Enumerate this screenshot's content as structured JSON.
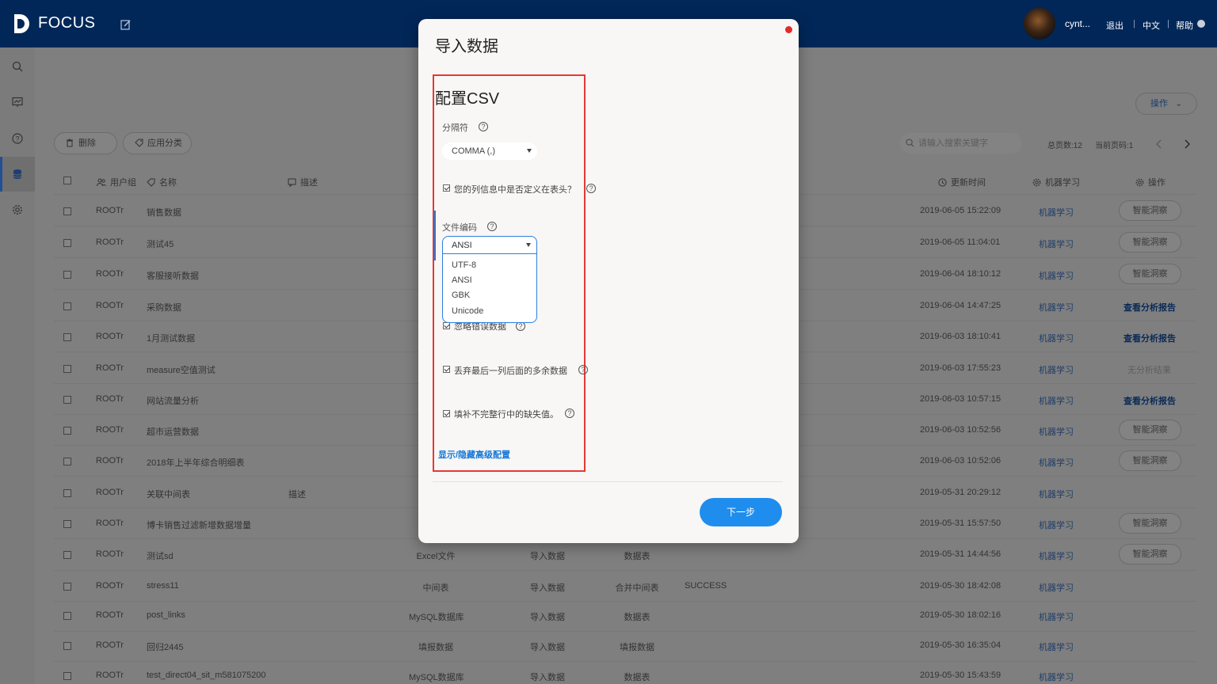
{
  "header": {
    "logo_text": "FOCUS",
    "user_name": "cynt...",
    "logout": "退出",
    "language": "中文",
    "help": "帮助"
  },
  "toolbar": {
    "delete_label": "删除",
    "apply_category_label": "应用分类",
    "operation_label": "操作",
    "search_placeholder": "请输入搜索关键字",
    "total_pages": "总页数:12",
    "current_page": "当前页码:1"
  },
  "table": {
    "headers": {
      "user_group": "用户组",
      "name": "名称",
      "description": "描述",
      "update_time": "更新时间",
      "ml": "机器学习",
      "operation": "操作"
    },
    "rows": [
      {
        "user": "ROOTr",
        "name": "销售数据",
        "desc": "",
        "type": "",
        "source": "",
        "target": "",
        "status": "",
        "time": "2019-06-05 15:22:09",
        "ml": "机器学习",
        "op": "智能洞察",
        "op_style": "button"
      },
      {
        "user": "ROOTr",
        "name": "测试45",
        "desc": "",
        "type": "",
        "source": "",
        "target": "",
        "status": "",
        "time": "2019-06-05 11:04:01",
        "ml": "机器学习",
        "op": "智能洞察",
        "op_style": "button"
      },
      {
        "user": "ROOTr",
        "name": "客服接听数据",
        "desc": "",
        "type": "",
        "source": "",
        "target": "",
        "status": "",
        "time": "2019-06-04 18:10:12",
        "ml": "机器学习",
        "op": "智能洞察",
        "op_style": "button"
      },
      {
        "user": "ROOTr",
        "name": "采购数据",
        "desc": "",
        "type": "",
        "source": "",
        "target": "",
        "status": "",
        "time": "2019-06-04 14:47:25",
        "ml": "机器学习",
        "op": "查看分析报告",
        "op_style": "report"
      },
      {
        "user": "ROOTr",
        "name": "1月测试数据",
        "desc": "",
        "type": "",
        "source": "",
        "target": "",
        "status": "",
        "time": "2019-06-03 18:10:41",
        "ml": "机器学习",
        "op": "查看分析报告",
        "op_style": "report"
      },
      {
        "user": "ROOTr",
        "name": "measure空值测试",
        "desc": "",
        "type": "",
        "source": "",
        "target": "",
        "status": "",
        "time": "2019-06-03 17:55:23",
        "ml": "机器学习",
        "op": "无分析结果",
        "op_style": "none"
      },
      {
        "user": "ROOTr",
        "name": "网站流量分析",
        "desc": "",
        "type": "",
        "source": "",
        "target": "",
        "status": "",
        "time": "2019-06-03 10:57:15",
        "ml": "机器学习",
        "op": "查看分析报告",
        "op_style": "report"
      },
      {
        "user": "ROOTr",
        "name": "超市运营数据",
        "desc": "",
        "type": "",
        "source": "",
        "target": "",
        "status": "",
        "time": "2019-06-03 10:52:56",
        "ml": "机器学习",
        "op": "智能洞察",
        "op_style": "button"
      },
      {
        "user": "ROOTr",
        "name": "2018年上半年综合明细表",
        "desc": "",
        "type": "",
        "source": "",
        "target": "",
        "status": "",
        "time": "2019-06-03 10:52:06",
        "ml": "机器学习",
        "op": "智能洞察",
        "op_style": "button"
      },
      {
        "user": "ROOTr",
        "name": "关联中间表",
        "desc": "描述",
        "type": "",
        "source": "",
        "target": "",
        "status": "",
        "time": "2019-05-31 20:29:12",
        "ml": "机器学习",
        "op": "",
        "op_style": ""
      },
      {
        "user": "ROOTr",
        "name": "博卡销售过滤新增数据增量",
        "desc": "",
        "type": "",
        "source": "",
        "target": "",
        "status": "",
        "time": "2019-05-31 15:57:50",
        "ml": "机器学习",
        "op": "智能洞察",
        "op_style": "button"
      },
      {
        "user": "ROOTr",
        "name": "测试sd",
        "desc": "",
        "type": "Excel文件",
        "source": "导入数据",
        "target": "数据表",
        "status": "",
        "time": "2019-05-31 14:44:56",
        "ml": "机器学习",
        "op": "智能洞察",
        "op_style": "button"
      },
      {
        "user": "ROOTr",
        "name": "stress11",
        "desc": "",
        "type": "中间表",
        "source": "导入数据",
        "target": "合并中间表",
        "status": "SUCCESS",
        "time": "2019-05-30 18:42:08",
        "ml": "机器学习",
        "op": "",
        "op_style": ""
      },
      {
        "user": "ROOTr",
        "name": "post_links",
        "desc": "",
        "type": "MySQL数据库",
        "source": "导入数据",
        "target": "数据表",
        "status": "",
        "time": "2019-05-30 18:02:16",
        "ml": "机器学习",
        "op": "",
        "op_style": ""
      },
      {
        "user": "ROOTr",
        "name": "回归2445",
        "desc": "",
        "type": "填报数据",
        "source": "导入数据",
        "target": "填报数据",
        "status": "",
        "time": "2019-05-30 16:35:04",
        "ml": "机器学习",
        "op": "",
        "op_style": ""
      },
      {
        "user": "ROOTr",
        "name": "test_direct04_sit_m581075200",
        "desc": "",
        "type": "MySQL数据库",
        "source": "导入数据",
        "target": "数据表",
        "status": "",
        "time": "2019-05-30 15:43:59",
        "ml": "机器学习",
        "op": "",
        "op_style": ""
      }
    ]
  },
  "modal": {
    "title": "导入数据",
    "section_title": "配置CSV",
    "delimiter_label": "分隔符",
    "delimiter_value": "COMMA (,)",
    "header_checkbox_label": "您的列信息中是否定义在表头？",
    "encoding_label": "文件编码",
    "encoding_value": "ANSI",
    "encoding_options": [
      "UTF-8",
      "ANSI",
      "GBK",
      "Unicode"
    ],
    "ignore_errors_label": "忽略错误数据",
    "drop_extra_label": "丢弃最后一列后面的多余数据",
    "fill_missing_label": "填补不完整行中的缺失值。",
    "advanced_link": "显示/隐藏高级配置",
    "next_button": "下一步"
  },
  "colors": {
    "header_bg": "#012759",
    "accent": "#1f8ded",
    "highlight_frame": "#e53935"
  }
}
